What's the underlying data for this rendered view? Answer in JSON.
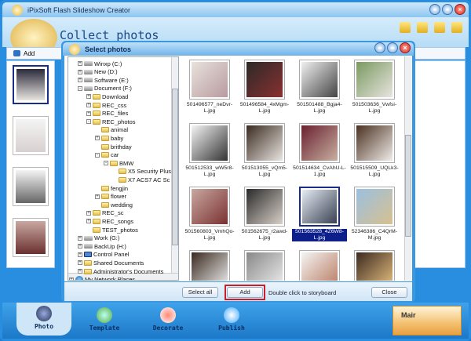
{
  "window": {
    "title": "iPixSoft Flash Slideshow Creator"
  },
  "header": {
    "title": "Collect photos"
  },
  "toolbar": {
    "add_label": "Add"
  },
  "dialog": {
    "title": "Select photos",
    "tree": [
      {
        "label": "Winxp (C:)",
        "level": 0,
        "type": "drive",
        "exp": "+"
      },
      {
        "label": "New (D:)",
        "level": 0,
        "type": "drive",
        "exp": "+"
      },
      {
        "label": "Software (E:)",
        "level": 0,
        "type": "drive",
        "exp": "+"
      },
      {
        "label": "Document (F:)",
        "level": 0,
        "type": "drive",
        "exp": "-"
      },
      {
        "label": "Download",
        "level": 1,
        "type": "folder",
        "exp": "+"
      },
      {
        "label": "REC_css",
        "level": 1,
        "type": "folder",
        "exp": "+"
      },
      {
        "label": "REC_files",
        "level": 1,
        "type": "folder",
        "exp": "+"
      },
      {
        "label": "REC_photos",
        "level": 1,
        "type": "folder",
        "exp": "-"
      },
      {
        "label": "animal",
        "level": 2,
        "type": "folder",
        "exp": ""
      },
      {
        "label": "baby",
        "level": 2,
        "type": "folder",
        "exp": "+"
      },
      {
        "label": "brithday",
        "level": 2,
        "type": "folder",
        "exp": ""
      },
      {
        "label": "car",
        "level": 2,
        "type": "folder",
        "exp": "-"
      },
      {
        "label": "BMW",
        "level": 3,
        "type": "folder",
        "exp": "-"
      },
      {
        "label": "X5 Security Plus",
        "level": 4,
        "type": "folder",
        "exp": ""
      },
      {
        "label": "X7 ACS7 AC Sc",
        "level": 4,
        "type": "folder",
        "exp": ""
      },
      {
        "label": "fengjin",
        "level": 2,
        "type": "folder",
        "exp": ""
      },
      {
        "label": "flower",
        "level": 2,
        "type": "folder",
        "exp": "+"
      },
      {
        "label": "wedding",
        "level": 2,
        "type": "folder",
        "exp": ""
      },
      {
        "label": "REC_sc",
        "level": 1,
        "type": "folder",
        "exp": "+"
      },
      {
        "label": "REC_songs",
        "level": 1,
        "type": "folder",
        "exp": "+"
      },
      {
        "label": "TEST_photos",
        "level": 1,
        "type": "folder",
        "exp": ""
      },
      {
        "label": "Work (G:)",
        "level": 0,
        "type": "drive",
        "exp": "+"
      },
      {
        "label": "BackUp (H:)",
        "level": 0,
        "type": "drive",
        "exp": "+"
      },
      {
        "label": "Control Panel",
        "level": 0,
        "type": "panel",
        "exp": "+"
      },
      {
        "label": "Shared Documents",
        "level": 0,
        "type": "folder",
        "exp": "+"
      },
      {
        "label": "Administrator's Documents",
        "level": 0,
        "type": "folder",
        "exp": "+"
      },
      {
        "label": "My Network Places",
        "level": -1,
        "type": "network",
        "exp": "+"
      }
    ],
    "photos": [
      {
        "name": "501496577_neDvr-L.jpg",
        "selected": false,
        "c": [
          "#e8e2dc",
          "#b89aa0"
        ]
      },
      {
        "name": "501496584_4xMgm-L.jpg",
        "selected": false,
        "c": [
          "#2a2a28",
          "#8a3030"
        ]
      },
      {
        "name": "501501488_Bgja4-L.jpg",
        "selected": false,
        "c": [
          "#f0f0f0",
          "#444"
        ]
      },
      {
        "name": "501503636_Vwfsi-L.jpg",
        "selected": false,
        "c": [
          "#7a9a60",
          "#e8e4e0"
        ]
      },
      {
        "name": "501512533_wW5r8-L.jpg",
        "selected": false,
        "c": [
          "#f4f4f4",
          "#333"
        ]
      },
      {
        "name": "501513055_vQm5-L.jpg",
        "selected": false,
        "c": [
          "#3a2a20",
          "#e8e4e0"
        ]
      },
      {
        "name": "501514634_CvAhU-L-1.jpg",
        "selected": false,
        "c": [
          "#6a2030",
          "#c8b0a0"
        ]
      },
      {
        "name": "501515509_UQLk3-L.jpg",
        "selected": false,
        "c": [
          "#4a3020",
          "#f0ece8"
        ]
      },
      {
        "name": "501560803_VmhQo-L.jpg",
        "selected": false,
        "c": [
          "#c8a8a0",
          "#7a3030"
        ]
      },
      {
        "name": "501562675_r2awd-L.jpg",
        "selected": false,
        "c": [
          "#2a2a2a",
          "#d8d0c8"
        ]
      },
      {
        "name": "501563528_4Z6W8-L.jpg",
        "selected": true,
        "c": [
          "#e4ecf4",
          "#3a4050"
        ]
      },
      {
        "name": "52346386_C4QrM-M.jpg",
        "selected": false,
        "c": [
          "#9ac0e0",
          "#d8c090"
        ]
      },
      {
        "name": "",
        "selected": false,
        "c": [
          "#3a2a20",
          "#f0f0f0"
        ]
      },
      {
        "name": "",
        "selected": false,
        "c": [
          "#888",
          "#eee"
        ]
      },
      {
        "name": "",
        "selected": false,
        "c": [
          "#f4f4f4",
          "#b87a60"
        ]
      },
      {
        "name": "",
        "selected": false,
        "c": [
          "#3a2a20",
          "#e8c080"
        ]
      }
    ],
    "select_all_label": "Select all",
    "add_label": "Add",
    "hint": "Double click to storyboard",
    "close_label": "Close"
  },
  "tabs": [
    {
      "label": "Photo"
    },
    {
      "label": "Template"
    },
    {
      "label": "Decorate"
    },
    {
      "label": "Publish"
    }
  ],
  "promo": {
    "text": "Mair"
  }
}
